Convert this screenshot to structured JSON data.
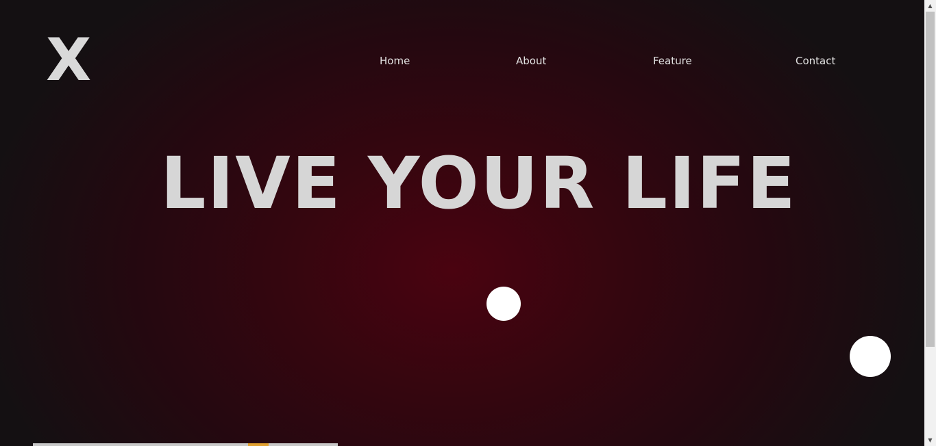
{
  "logo": {
    "text": "X"
  },
  "nav": {
    "items": [
      {
        "label": "Home"
      },
      {
        "label": "About"
      },
      {
        "label": "Feature"
      },
      {
        "label": "Contact"
      }
    ]
  },
  "hero": {
    "headline": "LIVE YOUR LIFE"
  },
  "colors": {
    "background_center": "#4a0310",
    "background_edge": "#141012",
    "text": "#d6d6d6",
    "dots": "#ffffff"
  },
  "scrollbar": {
    "up_icon": "triangle-up-icon",
    "down_icon": "triangle-down-icon"
  }
}
